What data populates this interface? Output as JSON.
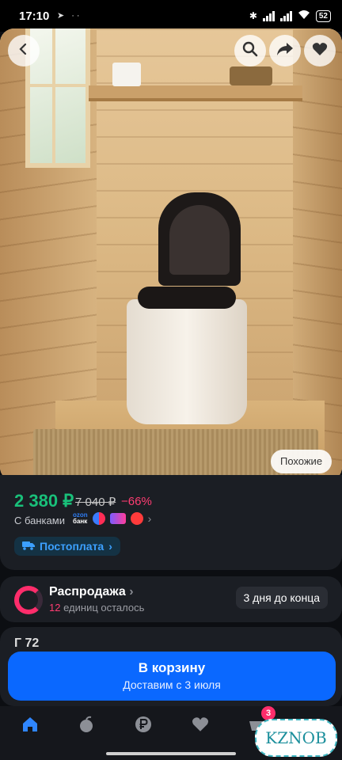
{
  "status_bar": {
    "time": "17:10",
    "battery": "52"
  },
  "hero": {
    "similar_label": "Похожие",
    "icons": [
      "back-icon",
      "search-icon",
      "share-icon",
      "heart-icon"
    ]
  },
  "price": {
    "current": "2 380 ₽",
    "old": "7 040 ₽",
    "discount": "−66%",
    "banks_label": "С банками",
    "ozon_bank": [
      "ozon",
      "банк"
    ],
    "postpay_label": "Постоплата"
  },
  "sale": {
    "title": "Распродажа",
    "count": "12",
    "remaining_text": "единиц осталось",
    "days_left": "3 дня до конца"
  },
  "peek": {
    "text": "Г          72"
  },
  "cart": {
    "label": "В корзину",
    "delivery": "Доставим с 3 июля"
  },
  "nav": {
    "items": [
      "home-icon",
      "fruit-icon",
      "ruble-icon",
      "heart-icon",
      "cart-icon"
    ],
    "cart_badge": "3"
  },
  "watermark": "KZNOB",
  "colors": {
    "accent_blue": "#0a68ff",
    "price_green": "#19c07a",
    "discount_pink": "#ff3d72",
    "background": "#0c0e12"
  }
}
